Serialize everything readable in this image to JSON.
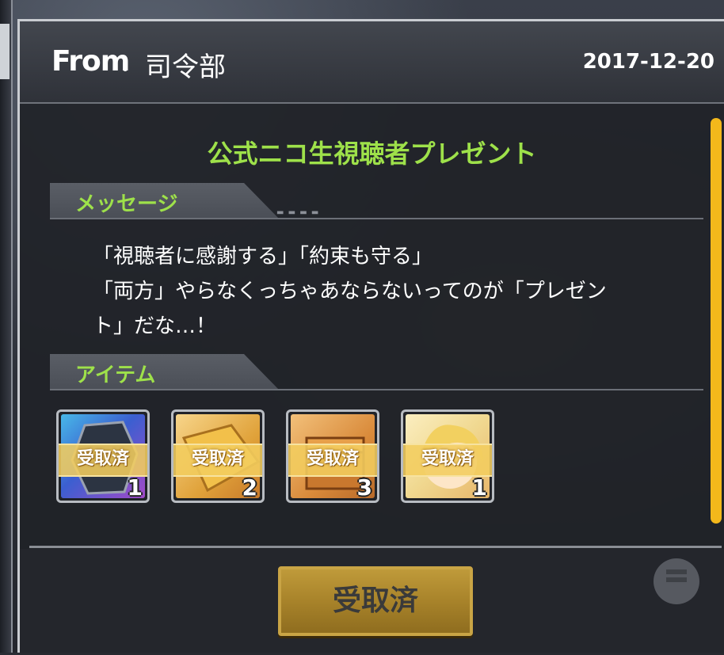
{
  "header": {
    "from_label": "From",
    "from_separator": ":",
    "from_value": "司令部",
    "date": "2017-12-20"
  },
  "mail": {
    "title": "公式ニコ生視聴者プレゼント",
    "message_section_label": "メッセージ",
    "message_lines": [
      "「視聴者に感謝する」「約束も守る」",
      "「両方」やらなくっちゃあならないってのが「プレゼン",
      "ト」だな…！"
    ],
    "items_section_label": "アイテム",
    "items": [
      {
        "icon": "gear-badge-icon",
        "status": "受取済",
        "quantity": "1",
        "color": "#3b5fd0"
      },
      {
        "icon": "ticket-icon",
        "status": "受取済",
        "quantity": "2",
        "color": "#e0a23a"
      },
      {
        "icon": "treasure-box-icon",
        "status": "受取済",
        "quantity": "3",
        "color": "#d98a3a"
      },
      {
        "icon": "character-portrait-icon",
        "status": "受取済",
        "quantity": "1",
        "color": "#f0d890"
      }
    ]
  },
  "footer": {
    "claim_button_label": "受取済"
  },
  "colors": {
    "accent_green": "#9ee14a",
    "scrollbar": "#f3b81b",
    "button_gold": "#a8832a"
  }
}
